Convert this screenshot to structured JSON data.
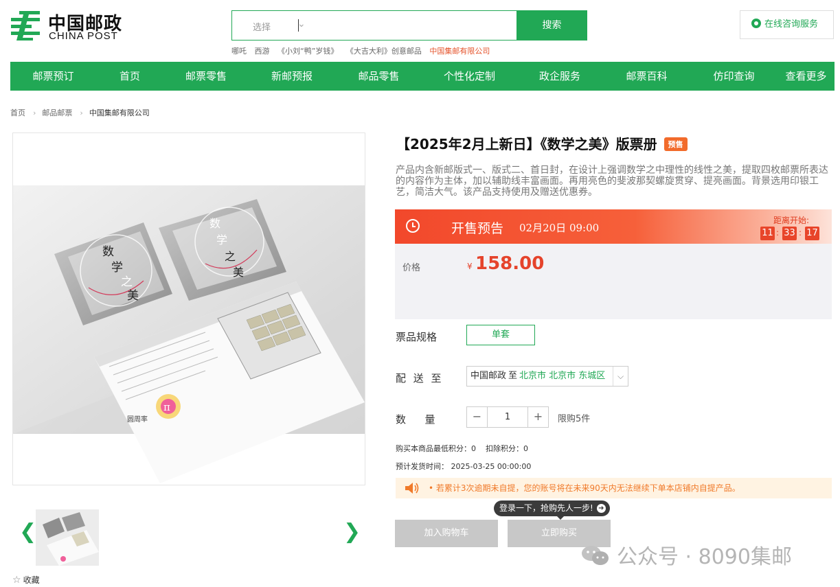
{
  "logo": {
    "cn": "中国邮政",
    "en": "CHINA POST"
  },
  "search": {
    "select_label": "选择",
    "button_label": "搜索",
    "hot_words": [
      "哪吒",
      "西游",
      "《小刘“鸭”岁钱》",
      "《大吉大利》创意邮品"
    ],
    "hot_company": "中国集邮有限公司"
  },
  "service": {
    "label": "在线咨询服务"
  },
  "nav": [
    "邮票预订",
    "首页",
    "邮票零售",
    "新邮预报",
    "邮品零售",
    "个性化定制",
    "政企服务",
    "邮票百科",
    "仿印查询",
    "查看更多"
  ],
  "breadcrumb": [
    "首页",
    "邮品邮票",
    "中国集邮有限公司"
  ],
  "gallery": {
    "prev": "❮",
    "next": "❯",
    "favorite": "收藏"
  },
  "product": {
    "title": "【2025年2月上新日】《数学之美》版票册",
    "tag": "预售",
    "description": "产品内含新邮版式一、版式二、首日封，在设计上强调数学之中理性的线性之美，提取四枚邮票所表达的内容作为主体，加以辅助线丰富画面。再用亮色的斐波那契螺旋贯穿、提亮画面。背景选用印银工艺，简洁大气。该产品支持使用及赠送优惠券。",
    "presale_label": "开售预告",
    "presale_time": "02月20日 09:00",
    "countdown_label": "距离开始:",
    "countdown": [
      "11",
      "33",
      "17"
    ],
    "price_label": "价格",
    "currency": "¥",
    "price": "158.00",
    "spec_label": "票品规格",
    "spec_option": "单套",
    "delivery_label": "配 送 至",
    "delivery_carrier": "中国邮政",
    "delivery_to": "至",
    "delivery_address": "北京市 北京市 东城区",
    "qty_label": "数  量",
    "qty_minus": "−",
    "qty_value": "1",
    "qty_plus": "+",
    "qty_limit": "限购5件",
    "points_line": "购买本商品最低积分：0    扣除积分：0",
    "ship_time_line": "预计发货时间： 2025-03-25 00:00:00",
    "notice": "•  若累计3次逾期未自提，您的账号将在未来90天内无法继续下单本店铺内自提产品。",
    "login_tip": "登录一下，抢购先人一步!",
    "login_tip_arrow": "➜",
    "add_cart": "加入购物车",
    "buy_now": "立即购买"
  },
  "stamp_art": {
    "text": [
      "数",
      "学",
      "之",
      "美"
    ],
    "pi": "π",
    "booklet_title": "圆周率"
  },
  "watermark": "公众号 · 8090集邮",
  "colors": {
    "brand_green": "#21a855",
    "price_red": "#e5432b",
    "presale_orange": "#f2482b"
  }
}
